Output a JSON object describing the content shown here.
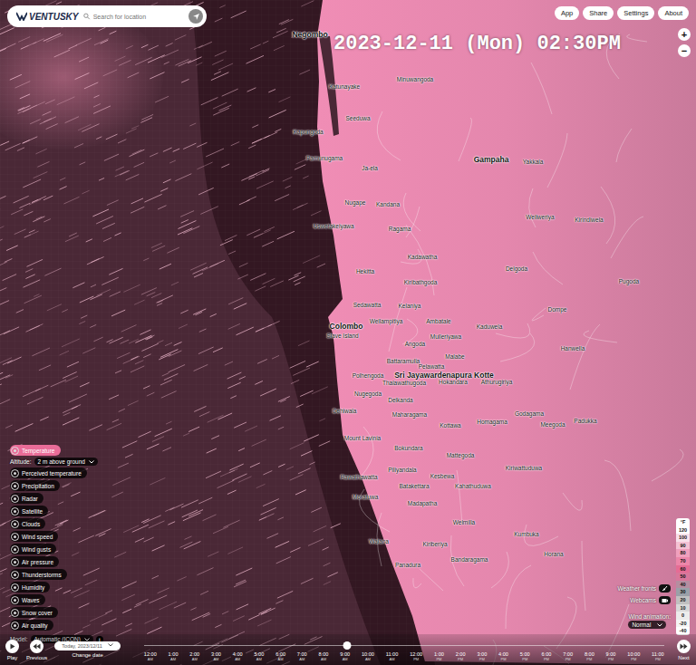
{
  "header": {
    "logo": "VENTUSKY",
    "search_placeholder": "Search for location",
    "buttons": [
      "App",
      "Share",
      "Settings",
      "About"
    ]
  },
  "datetime": "2023-12-11 (Mon) 02:30PM",
  "zoom": [
    "+",
    "−"
  ],
  "layers": [
    {
      "label": "Temperature",
      "selected": true
    },
    {
      "label": "Perceived temperature",
      "selected": false
    },
    {
      "label": "Precipitation",
      "selected": false
    },
    {
      "label": "Radar",
      "selected": false
    },
    {
      "label": "Satellite",
      "selected": false
    },
    {
      "label": "Clouds",
      "selected": false
    },
    {
      "label": "Wind speed",
      "selected": false
    },
    {
      "label": "Wind gusts",
      "selected": false
    },
    {
      "label": "Air pressure",
      "selected": false
    },
    {
      "label": "Thunderstorms",
      "selected": false
    },
    {
      "label": "Humidity",
      "selected": false
    },
    {
      "label": "Waves",
      "selected": false
    },
    {
      "label": "Snow cover",
      "selected": false
    },
    {
      "label": "Air quality",
      "selected": false
    }
  ],
  "altitude": {
    "label": "Altitude:",
    "value": "2 m above ground"
  },
  "model": {
    "label": "Model:",
    "value": "Automatic (ICON)",
    "info": "i"
  },
  "places": [
    {
      "name": "Negombo",
      "major": true
    },
    {
      "name": "Katunayake",
      "major": false
    },
    {
      "name": "Seeduwa",
      "major": false
    },
    {
      "name": "Kapungoda",
      "major": false
    },
    {
      "name": "Pamunugama",
      "major": false
    },
    {
      "name": "Ja-ela",
      "major": false
    },
    {
      "name": "Minuwangoda",
      "major": false
    },
    {
      "name": "Gampaha",
      "major": true
    },
    {
      "name": "Yakkala",
      "major": false
    },
    {
      "name": "Kandana",
      "major": false
    },
    {
      "name": "Ragama",
      "major": false
    },
    {
      "name": "Nugape",
      "major": false
    },
    {
      "name": "Uswetakeiyawa",
      "major": false
    },
    {
      "name": "Hekitta",
      "major": false
    },
    {
      "name": "Kadawatha",
      "major": false
    },
    {
      "name": "Kiribathgoda",
      "major": false
    },
    {
      "name": "Sedawatta",
      "major": false
    },
    {
      "name": "Kelaniya",
      "major": false
    },
    {
      "name": "Wellampitiya",
      "major": false
    },
    {
      "name": "Ambatale",
      "major": false
    },
    {
      "name": "Colombo",
      "major": true
    },
    {
      "name": "Slave Island",
      "major": false
    },
    {
      "name": "Kaduwela",
      "major": false
    },
    {
      "name": "Mulleriyawa",
      "major": false
    },
    {
      "name": "Angoda",
      "major": false
    },
    {
      "name": "Malabe",
      "major": false
    },
    {
      "name": "Battaramulla",
      "major": false
    },
    {
      "name": "Pelawatta",
      "major": false
    },
    {
      "name": "Sri Jayawardenapura Kotte",
      "major": true
    },
    {
      "name": "Hokandara",
      "major": false
    },
    {
      "name": "Thalawathugoda",
      "major": false
    },
    {
      "name": "Athurugiriya",
      "major": false
    },
    {
      "name": "Polhengoda",
      "major": false
    },
    {
      "name": "Nugegoda",
      "major": false
    },
    {
      "name": "Delkanda",
      "major": false
    },
    {
      "name": "Dehiwala",
      "major": false
    },
    {
      "name": "Maharagama",
      "major": false
    },
    {
      "name": "Mount Lavinia",
      "major": false
    },
    {
      "name": "Kottawa",
      "major": false
    },
    {
      "name": "Homagama",
      "major": false
    },
    {
      "name": "Godagama",
      "major": false
    },
    {
      "name": "Meegoda",
      "major": false
    },
    {
      "name": "Padukka",
      "major": false
    },
    {
      "name": "Hanwella",
      "major": false
    },
    {
      "name": "Delgoda",
      "major": false
    },
    {
      "name": "Dompe",
      "major": false
    },
    {
      "name": "Pugoda",
      "major": false
    },
    {
      "name": "Bokundara",
      "major": false
    },
    {
      "name": "Mattegoda",
      "major": false
    },
    {
      "name": "Piliyandala",
      "major": false
    },
    {
      "name": "Kesbewa",
      "major": false
    },
    {
      "name": "Kiriwattuduwa",
      "major": false
    },
    {
      "name": "Rawathawatta",
      "major": false
    },
    {
      "name": "Batakettara",
      "major": false
    },
    {
      "name": "Moratuwa",
      "major": false
    },
    {
      "name": "Madapatha",
      "major": false
    },
    {
      "name": "Kahathuduwa",
      "major": false
    },
    {
      "name": "Welmilla",
      "major": false
    },
    {
      "name": "Walana",
      "major": false
    },
    {
      "name": "Kiriberiya",
      "major": false
    },
    {
      "name": "Bandaragama",
      "major": false
    },
    {
      "name": "Panadura",
      "major": false
    },
    {
      "name": "Horana",
      "major": false
    },
    {
      "name": "Kumbuka",
      "major": false
    },
    {
      "name": "Weliweriya",
      "major": false
    },
    {
      "name": "Kirindiwela",
      "major": false
    }
  ],
  "legend": {
    "unit": "°F",
    "ticks": [
      "120",
      "100",
      "90",
      "80",
      "70",
      "60",
      "50",
      "40",
      "30",
      "20",
      "10",
      "0",
      "-20",
      "-40"
    ]
  },
  "toggles": [
    {
      "label": "Weather fronts",
      "on": false
    },
    {
      "label": "Webcams",
      "on": false
    }
  ],
  "wind_animation": {
    "label": "Wind animation:",
    "value": "Normal"
  },
  "timeline": {
    "play": "Play",
    "previous": "Previous",
    "date": "Today, 2023/12/11",
    "change_date": "Change date",
    "next": "Next",
    "level": 0.39,
    "hours": [
      {
        "time": "12:00",
        "ampm": "AM"
      },
      {
        "time": "1:00",
        "ampm": "AM"
      },
      {
        "time": "2:00",
        "ampm": "AM"
      },
      {
        "time": "3:00",
        "ampm": "AM"
      },
      {
        "time": "4:00",
        "ampm": "AM"
      },
      {
        "time": "5:00",
        "ampm": "AM"
      },
      {
        "time": "6:00",
        "ampm": "AM"
      },
      {
        "time": "7:00",
        "ampm": "AM"
      },
      {
        "time": "8:00",
        "ampm": "AM"
      },
      {
        "time": "9:00",
        "ampm": "AM"
      },
      {
        "time": "10:00",
        "ampm": "AM"
      },
      {
        "time": "11:00",
        "ampm": "AM"
      },
      {
        "time": "12:00",
        "ampm": "PM"
      },
      {
        "time": "1:00",
        "ampm": "PM"
      },
      {
        "time": "2:00",
        "ampm": "PM"
      },
      {
        "time": "3:00",
        "ampm": "PM"
      },
      {
        "time": "4:00",
        "ampm": "PM"
      },
      {
        "time": "5:00",
        "ampm": "PM"
      },
      {
        "time": "6:00",
        "ampm": "PM"
      },
      {
        "time": "7:00",
        "ampm": "PM"
      },
      {
        "time": "8:00",
        "ampm": "PM"
      },
      {
        "time": "9:00",
        "ampm": "PM"
      },
      {
        "time": "10:00",
        "ampm": "PM"
      },
      {
        "time": "11:00",
        "ampm": "PM"
      }
    ]
  }
}
